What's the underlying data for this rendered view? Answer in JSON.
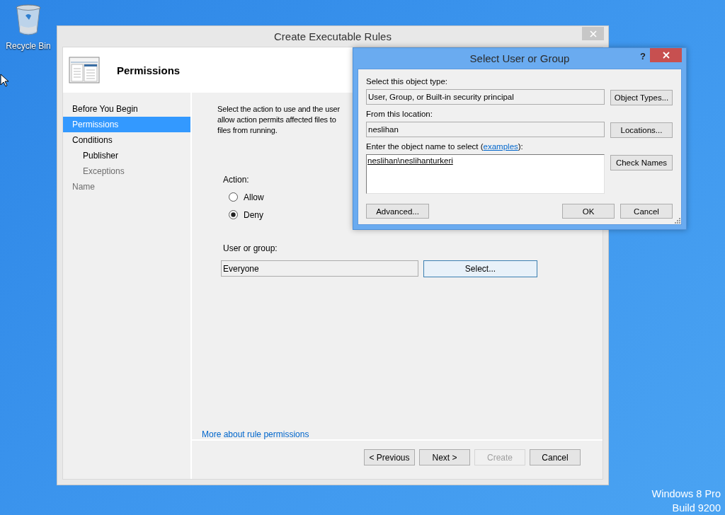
{
  "desktop": {
    "icons": [
      {
        "label": "Recycle Bin"
      }
    ],
    "edition": [
      "Windows 8 Pro",
      "Build 9200"
    ]
  },
  "wizard": {
    "title": "Create Executable Rules",
    "header": "Permissions",
    "steps": [
      {
        "label": "Before You Begin",
        "selected": false,
        "disabled": false
      },
      {
        "label": "Permissions",
        "selected": true,
        "disabled": false
      },
      {
        "label": "Conditions",
        "selected": false,
        "disabled": false,
        "children": [
          {
            "label": "Publisher",
            "selected": false,
            "disabled": false
          },
          {
            "label": "Exceptions",
            "selected": false,
            "disabled": true
          }
        ]
      },
      {
        "label": "Name",
        "selected": false,
        "disabled": true
      }
    ],
    "description": "Select the action to use and the user\nallow action permits affected files to\nfiles from running.",
    "action_label": "Action:",
    "actions": [
      {
        "label": "Allow",
        "selected": false
      },
      {
        "label": "Deny",
        "selected": true
      }
    ],
    "user_label": "User or group:",
    "user_value": "Everyone",
    "select_button": {
      "label": "Select...",
      "focused": true
    },
    "help_link": "More about rule permissions",
    "buttons": [
      {
        "label": "< Previous",
        "disabled": false
      },
      {
        "label": "Next >",
        "disabled": false
      },
      {
        "label": "Create",
        "disabled": true
      },
      {
        "label": "Cancel",
        "disabled": false
      }
    ]
  },
  "dialog": {
    "title": "Select User or Group",
    "help": "?",
    "object_type_label": "Select this object type:",
    "object_type": "User, Group, or Built-in security principal",
    "object_types_button": "Object Types...",
    "location_label": "From this location:",
    "location": "neslihan",
    "locations_button": "Locations...",
    "name_label_start": "Enter the object name to select (",
    "name_label_link": "examples",
    "name_label_end": "):",
    "names": "neslihan\\neslihanturkeri",
    "names_resolved": true,
    "check_names_button": "Check Names",
    "advanced_button": "Advanced...",
    "ok_button": "OK",
    "cancel_button": "Cancel"
  }
}
